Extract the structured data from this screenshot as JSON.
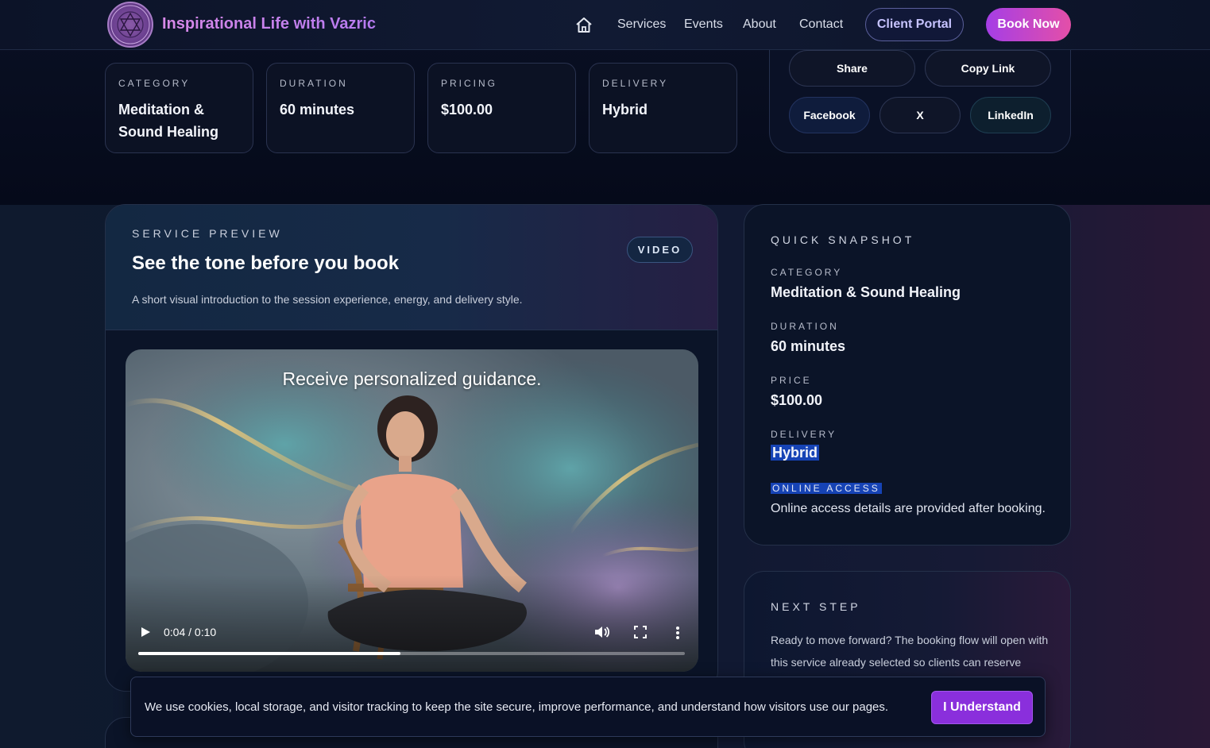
{
  "header": {
    "brand": "Inspirational Life with Vazric",
    "nav": [
      "Services",
      "Events",
      "About",
      "Contact"
    ],
    "client_portal": "Client Portal",
    "book_now": "Book Now"
  },
  "info_cards": [
    {
      "label": "CATEGORY",
      "value": "Meditation & Sound Healing"
    },
    {
      "label": "DURATION",
      "value": "60 minutes"
    },
    {
      "label": "PRICING",
      "value": "$100.00"
    },
    {
      "label": "DELIVERY",
      "value": "Hybrid"
    }
  ],
  "share": {
    "share": "Share",
    "copy_link": "Copy Link",
    "facebook": "Facebook",
    "x": "X",
    "linkedin": "LinkedIn"
  },
  "preview": {
    "eyebrow": "SERVICE PREVIEW",
    "title": "See the tone before you book",
    "subtitle": "A short visual introduction to the session experience, energy, and delivery style.",
    "badge": "VIDEO",
    "video_caption": "Receive personalized guidance.",
    "time": "0:04 / 0:10",
    "progress": 0.48
  },
  "snapshot": {
    "title": "QUICK SNAPSHOT",
    "category_label": "CATEGORY",
    "category": "Meditation & Sound Healing",
    "duration_label": "DURATION",
    "duration": "60 minutes",
    "price_label": "PRICE",
    "price": "$100.00",
    "delivery_label": "DELIVERY",
    "delivery": "Hybrid",
    "online_label": "ONLINE ACCESS",
    "online_note": "Online access details are provided after booking."
  },
  "next_step": {
    "title": "NEXT STEP",
    "body": "Ready to move forward? The booking flow will open with this service already selected so clients can reserve without re-choosing it."
  },
  "cookie": {
    "message": "We use cookies, local storage, and visitor tracking to keep the site secure, improve performance, and understand how visitors use our pages.",
    "button": "I Understand"
  },
  "colors": {
    "accent_purple": "#a53ee6",
    "accent_pink": "#e44fa8",
    "highlight": "#1643b5"
  }
}
